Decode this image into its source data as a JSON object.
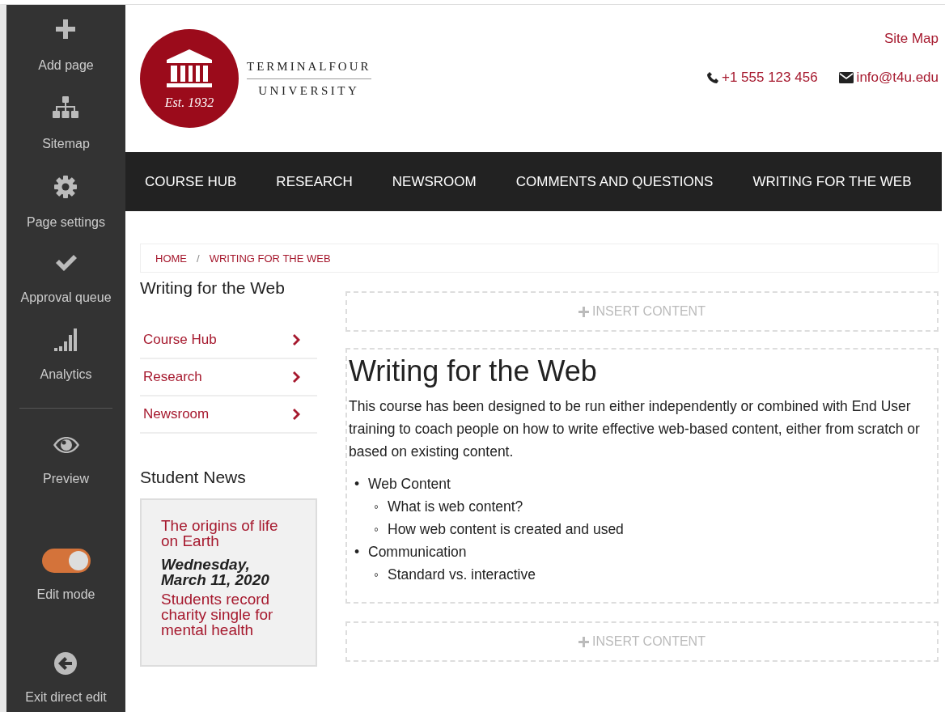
{
  "toolbar": {
    "items": [
      {
        "kind": "action",
        "label": "Add page"
      },
      {
        "kind": "action",
        "label": "Sitemap"
      },
      {
        "kind": "action",
        "label": "Page settings"
      },
      {
        "kind": "action",
        "label": "Approval queue"
      },
      {
        "kind": "action",
        "label": "Analytics"
      },
      {
        "kind": "divider"
      },
      {
        "kind": "action",
        "label": "Preview"
      },
      {
        "kind": "toggle",
        "label": "Edit mode",
        "on": true
      },
      {
        "kind": "action",
        "label": "Exit direct edit"
      }
    ]
  },
  "logo": {
    "name_top": "TERMINALFOUR",
    "name_bottom": "UNIVERSITY",
    "established": "Est. 1932"
  },
  "header_links": {
    "site_map": "Site Map",
    "phone": "+1 555 123 456",
    "email": "info@t4u.edu"
  },
  "nav": [
    "COURSE HUB",
    "RESEARCH",
    "NEWSROOM",
    "COMMENTS AND QUESTIONS",
    "WRITING FOR THE WEB"
  ],
  "breadcrumb": [
    "HOME",
    "WRITING FOR THE WEB"
  ],
  "breadcrumb_separator": "/",
  "section_menu": {
    "title": "Writing for the Web",
    "items": [
      "Course Hub",
      "Research",
      "Newsroom"
    ]
  },
  "student_news": {
    "title": "Student News",
    "items": [
      {
        "kind": "link",
        "text": "The origins of life on Earth"
      },
      {
        "kind": "date",
        "text": "Wednesday, March 11, 2020"
      },
      {
        "kind": "link",
        "text": "Students record charity single for mental health"
      }
    ]
  },
  "insert_label": "INSERT CONTENT",
  "article": {
    "title": "Writing for the Web",
    "intro": "This course has been designed to be run either independently or combined with End User training to coach people on how to write effective web-based content, either from scratch or based on existing content.",
    "list": [
      {
        "marker": "•",
        "text": "Web Content",
        "children": [
          {
            "marker": "◦",
            "text": "What is web content?"
          },
          {
            "marker": "◦",
            "text": "How web content is created and used"
          }
        ]
      },
      {
        "marker": "•",
        "text": "Communication",
        "children": [
          {
            "marker": "◦",
            "text": "Standard vs. interactive"
          }
        ]
      }
    ]
  },
  "insert_label_bottom": "INSERT CONTENT"
}
